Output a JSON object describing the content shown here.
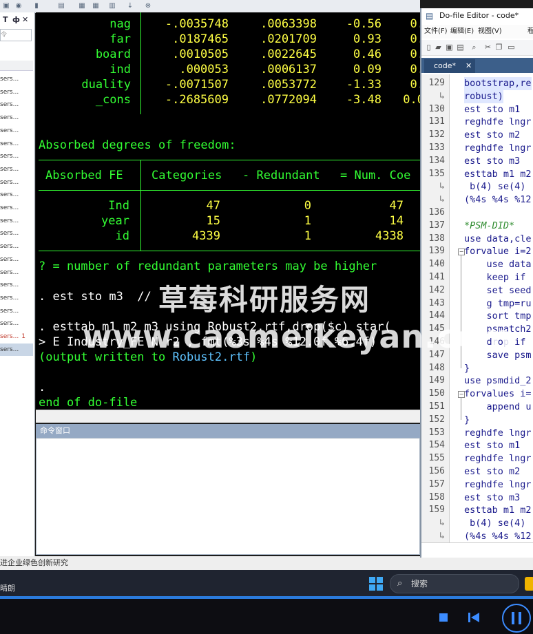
{
  "results": {
    "coef_rows": [
      {
        "var": "nag",
        "coef": "-.0035748",
        "se": ".0063398",
        "t": "-0.56",
        "p": "0."
      },
      {
        "var": "far",
        "coef": ".0187465",
        "se": ".0201709",
        "t": "0.93",
        "p": "0."
      },
      {
        "var": "board",
        "coef": ".0010505",
        "se": ".0022645",
        "t": "0.46",
        "p": "0."
      },
      {
        "var": "ind",
        "coef": ".000053",
        "se": ".0006137",
        "t": "0.09",
        "p": "0."
      },
      {
        "var": "duality",
        "coef": "-.0071507",
        "se": ".0053772",
        "t": "-1.33",
        "p": "0."
      },
      {
        "var": "_cons",
        "coef": "-.2685609",
        "se": ".0772094",
        "t": "-3.48",
        "p": "0.0"
      }
    ],
    "absorbed_title": "Absorbed degrees of freedom:",
    "fe_header": {
      "col1": "Absorbed FE",
      "col2": "Categories",
      "col3": "- Redundant",
      "col4": "= Num. Coe"
    },
    "fe_rows": [
      {
        "fe": "Ind",
        "cat": "47",
        "red": "0",
        "num": "47"
      },
      {
        "fe": "year",
        "cat": "15",
        "red": "1",
        "num": "14"
      },
      {
        "fe": "id",
        "cat": "4339",
        "red": "1",
        "num": "4338"
      }
    ],
    "note": "? = number of redundant parameters may be higher",
    "cmd1": ". est sto m3  //",
    "cmd2": ". esttab m1 m2 m3 using Robust2.rtf,drop($c) star(",
    "cmd3": "> E Industry_FE N r2 , fmt(%3s %4s %12.0f %6.4f)",
    "output_prefix": "(output written to ",
    "output_file": "Robust2.rtf",
    "output_suffix": ")",
    "dot": ".",
    "end": "end of do-file"
  },
  "command_window": {
    "title": "命令窗口"
  },
  "left_panel": {
    "t_label": "T",
    "pin_label": "ф",
    "close_label": "✕",
    "search_placeholder": "令",
    "items": [
      "sers...",
      "sers...",
      "sers...",
      "sers...",
      "sers...",
      "sers...",
      "sers...",
      "sers...",
      "sers...",
      "sers...",
      "sers...",
      "sers...",
      "sers...",
      "sers...",
      "sers...",
      "sers...",
      "sers...",
      "sers...",
      "sers...",
      "sers..."
    ],
    "red_item": "sers...",
    "red_item_count": "1",
    "selected_item": "sers..."
  },
  "status_bar": {
    "text": "进企业绿色创新研究"
  },
  "dofile": {
    "title": "Do-file Editor - code*",
    "menu": [
      "文件(F)",
      "编辑(E)",
      "视图(V)",
      "程"
    ],
    "tab_label": "code*",
    "lines": [
      {
        "n": "129",
        "code": "bootstrap,re"
      },
      {
        "n": "",
        "code": "robust)"
      },
      {
        "n": "130",
        "code": "est sto m1"
      },
      {
        "n": "131",
        "code": "reghdfe lngr"
      },
      {
        "n": "132",
        "code": "est sto m2"
      },
      {
        "n": "133",
        "code": "reghdfe lngr"
      },
      {
        "n": "134",
        "code": "est sto m3"
      },
      {
        "n": "135",
        "code": "esttab m1 m2"
      },
      {
        "n": "",
        "code": " b(4) se(4)"
      },
      {
        "n": "",
        "code": "(%4s %4s %12"
      },
      {
        "n": "136",
        "code": ""
      },
      {
        "n": "137",
        "code": "*PSM-DID*"
      },
      {
        "n": "138",
        "code": "use data,cle"
      },
      {
        "n": "139",
        "code": "forvalue i=2"
      },
      {
        "n": "140",
        "code": "    use data"
      },
      {
        "n": "141",
        "code": "    keep if"
      },
      {
        "n": "142",
        "code": "    set seed"
      },
      {
        "n": "143",
        "code": "    g tmp=ru"
      },
      {
        "n": "144",
        "code": "    sort tmp"
      },
      {
        "n": "145",
        "code": "    psmatch2"
      },
      {
        "n": "146",
        "code": "    drop if"
      },
      {
        "n": "147",
        "code": "    save psm"
      },
      {
        "n": "148",
        "code": "}"
      },
      {
        "n": "149",
        "code": "use psmdid_2"
      },
      {
        "n": "150",
        "code": "forvalues i="
      },
      {
        "n": "151",
        "code": "    append u"
      },
      {
        "n": "152",
        "code": "}"
      },
      {
        "n": "153",
        "code": "reghdfe lngr"
      },
      {
        "n": "154",
        "code": "est sto m1"
      },
      {
        "n": "155",
        "code": "reghdfe lngr"
      },
      {
        "n": "156",
        "code": "est sto m2"
      },
      {
        "n": "157",
        "code": "reghdfe lngr"
      },
      {
        "n": "158",
        "code": "est sto m3"
      },
      {
        "n": "159",
        "code": "esttab m1 m2"
      },
      {
        "n": "",
        "code": " b(4) se(4)"
      },
      {
        "n": "",
        "code": "(%4s %4s %12"
      }
    ]
  },
  "taskbar": {
    "weather": "晴朗",
    "search_placeholder": "搜索"
  },
  "watermark": {
    "line1": "草莓科研服务网",
    "line2": "www.caomeikeyan.com"
  },
  "colors": {
    "results_bg": "#000000",
    "results_green": "#33ff33",
    "results_yellow": "#ffff44",
    "accent_blue": "#2b7bdc"
  }
}
